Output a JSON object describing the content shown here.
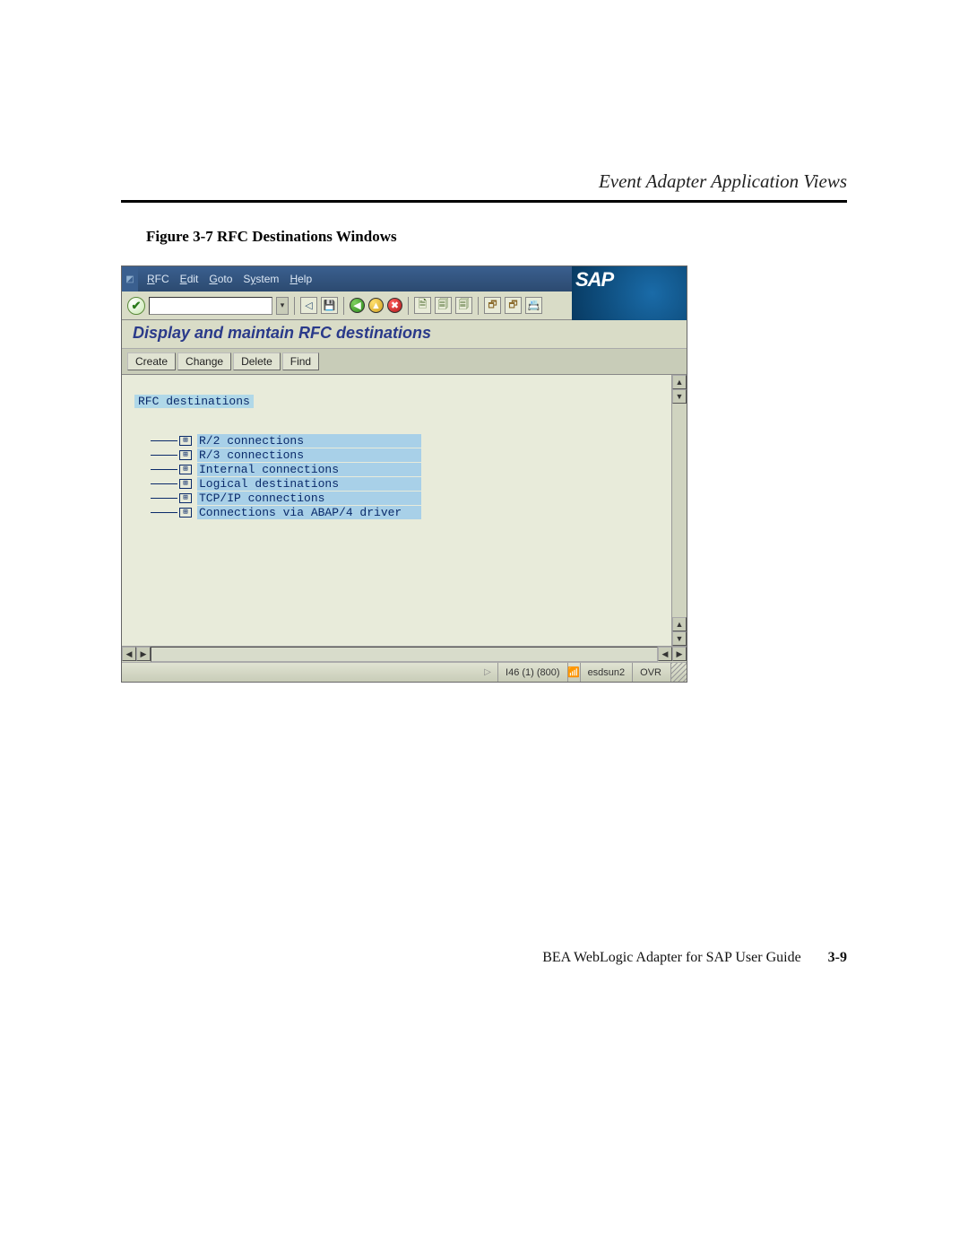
{
  "page": {
    "header_title": "Event Adapter Application Views",
    "figure_caption": "Figure 3-7   RFC Destinations Windows",
    "footer_text": "BEA WebLogic Adapter for SAP User Guide",
    "page_number": "3-9"
  },
  "sap": {
    "logo": "SAP",
    "menubar": {
      "rfc": "RFC",
      "edit": "Edit",
      "goto": "Goto",
      "system": "System",
      "help": "Help"
    },
    "screen_title": "Display and maintain RFC destinations",
    "action_buttons": {
      "create": "Create",
      "change": "Change",
      "delete": "Delete",
      "find": "Find"
    },
    "tree": {
      "root": "RFC destinations",
      "items": [
        {
          "label": "R/2 connections"
        },
        {
          "label": "R/3 connections"
        },
        {
          "label": "Internal connections"
        },
        {
          "label": "Logical destinations"
        },
        {
          "label": "TCP/IP connections"
        },
        {
          "label": "Connections via ABAP/4 driver"
        }
      ]
    },
    "statusbar": {
      "session": "I46 (1) (800)",
      "host": "esdsun2",
      "mode": "OVR"
    }
  }
}
